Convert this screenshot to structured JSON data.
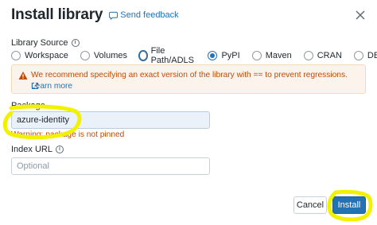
{
  "dialog": {
    "title": "Install library",
    "feedback_label": "Send feedback"
  },
  "library_source": {
    "label": "Library Source",
    "options": [
      "Workspace",
      "Volumes",
      "File Path/ADLS",
      "PyPI",
      "Maven",
      "CRAN",
      "DBFS"
    ],
    "selected": "PyPI"
  },
  "alert": {
    "message": "We recommend specifying an exact version of the library with == to prevent regressions.",
    "link_label": "Learn more"
  },
  "package": {
    "label": "Package",
    "value": "azure-identity",
    "warning": "Warning: package is not pinned"
  },
  "index_url": {
    "label": "Index URL",
    "placeholder": "Optional"
  },
  "footer": {
    "cancel_label": "Cancel",
    "install_label": "Install"
  },
  "colors": {
    "accent": "#2272b4",
    "warning": "#c24a00",
    "highlight": "#f2f200"
  },
  "icons": [
    "feedback-icon",
    "close-icon",
    "info-icon",
    "warning-icon",
    "external-link-icon"
  ]
}
